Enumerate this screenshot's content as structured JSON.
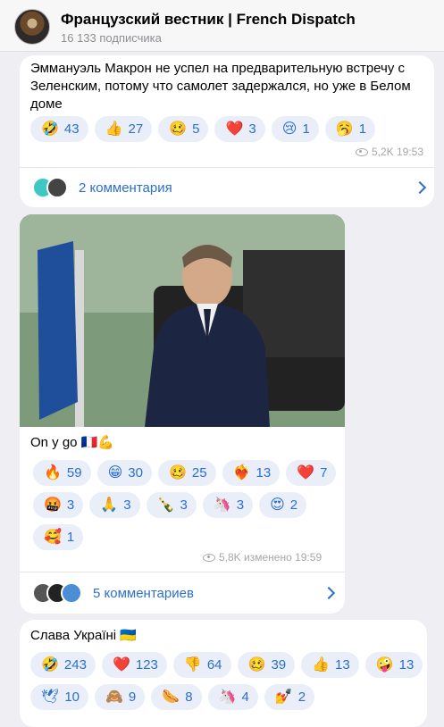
{
  "channel": {
    "title": "Французский вестник | French Dispatch",
    "subscribers": "16 133 подписчика"
  },
  "post1": {
    "text": "Эммануэль Макрон не успел на предварительную встречу с Зеленским, потому что самолет задержался, но уже в Белом доме",
    "reactions": [
      {
        "emoji": "🤣",
        "count": "43"
      },
      {
        "emoji": "👍",
        "count": "27"
      },
      {
        "emoji": "🥴",
        "count": "5"
      },
      {
        "emoji": "❤️",
        "count": "3"
      },
      {
        "emoji": "😢",
        "count": "1"
      },
      {
        "emoji": "🥱",
        "count": "1"
      }
    ],
    "meta": "5,2K 19:53",
    "comments": "2 комментария"
  },
  "post2": {
    "text": "On y go 🇫🇷💪",
    "reactions": [
      {
        "emoji": "🔥",
        "count": "59"
      },
      {
        "emoji": "😁",
        "count": "30"
      },
      {
        "emoji": "🥴",
        "count": "25"
      },
      {
        "emoji": "❤️‍🔥",
        "count": "13"
      },
      {
        "emoji": "❤️",
        "count": "7"
      },
      {
        "emoji": "🤬",
        "count": "3"
      },
      {
        "emoji": "🙏",
        "count": "3"
      },
      {
        "emoji": "🍾",
        "count": "3"
      },
      {
        "emoji": "🦄",
        "count": "3"
      },
      {
        "emoji": "😍",
        "count": "2"
      },
      {
        "emoji": "🥰",
        "count": "1"
      }
    ],
    "meta": "5,8K изменено 19:59",
    "comments": "5 комментариев"
  },
  "post3": {
    "text": "Слава Україні 🇺🇦",
    "reactions": [
      {
        "emoji": "🤣",
        "count": "243"
      },
      {
        "emoji": "❤️",
        "count": "123"
      },
      {
        "emoji": "👎",
        "count": "64"
      },
      {
        "emoji": "🥴",
        "count": "39"
      },
      {
        "emoji": "👍",
        "count": "13"
      },
      {
        "emoji": "🤪",
        "count": "13"
      },
      {
        "emoji": "🕊",
        "count": "10"
      },
      {
        "emoji": "🙈",
        "count": "9"
      },
      {
        "emoji": "🌭",
        "count": "8"
      },
      {
        "emoji": "🦄",
        "count": "4"
      },
      {
        "emoji": "💅",
        "count": "2"
      }
    ]
  }
}
